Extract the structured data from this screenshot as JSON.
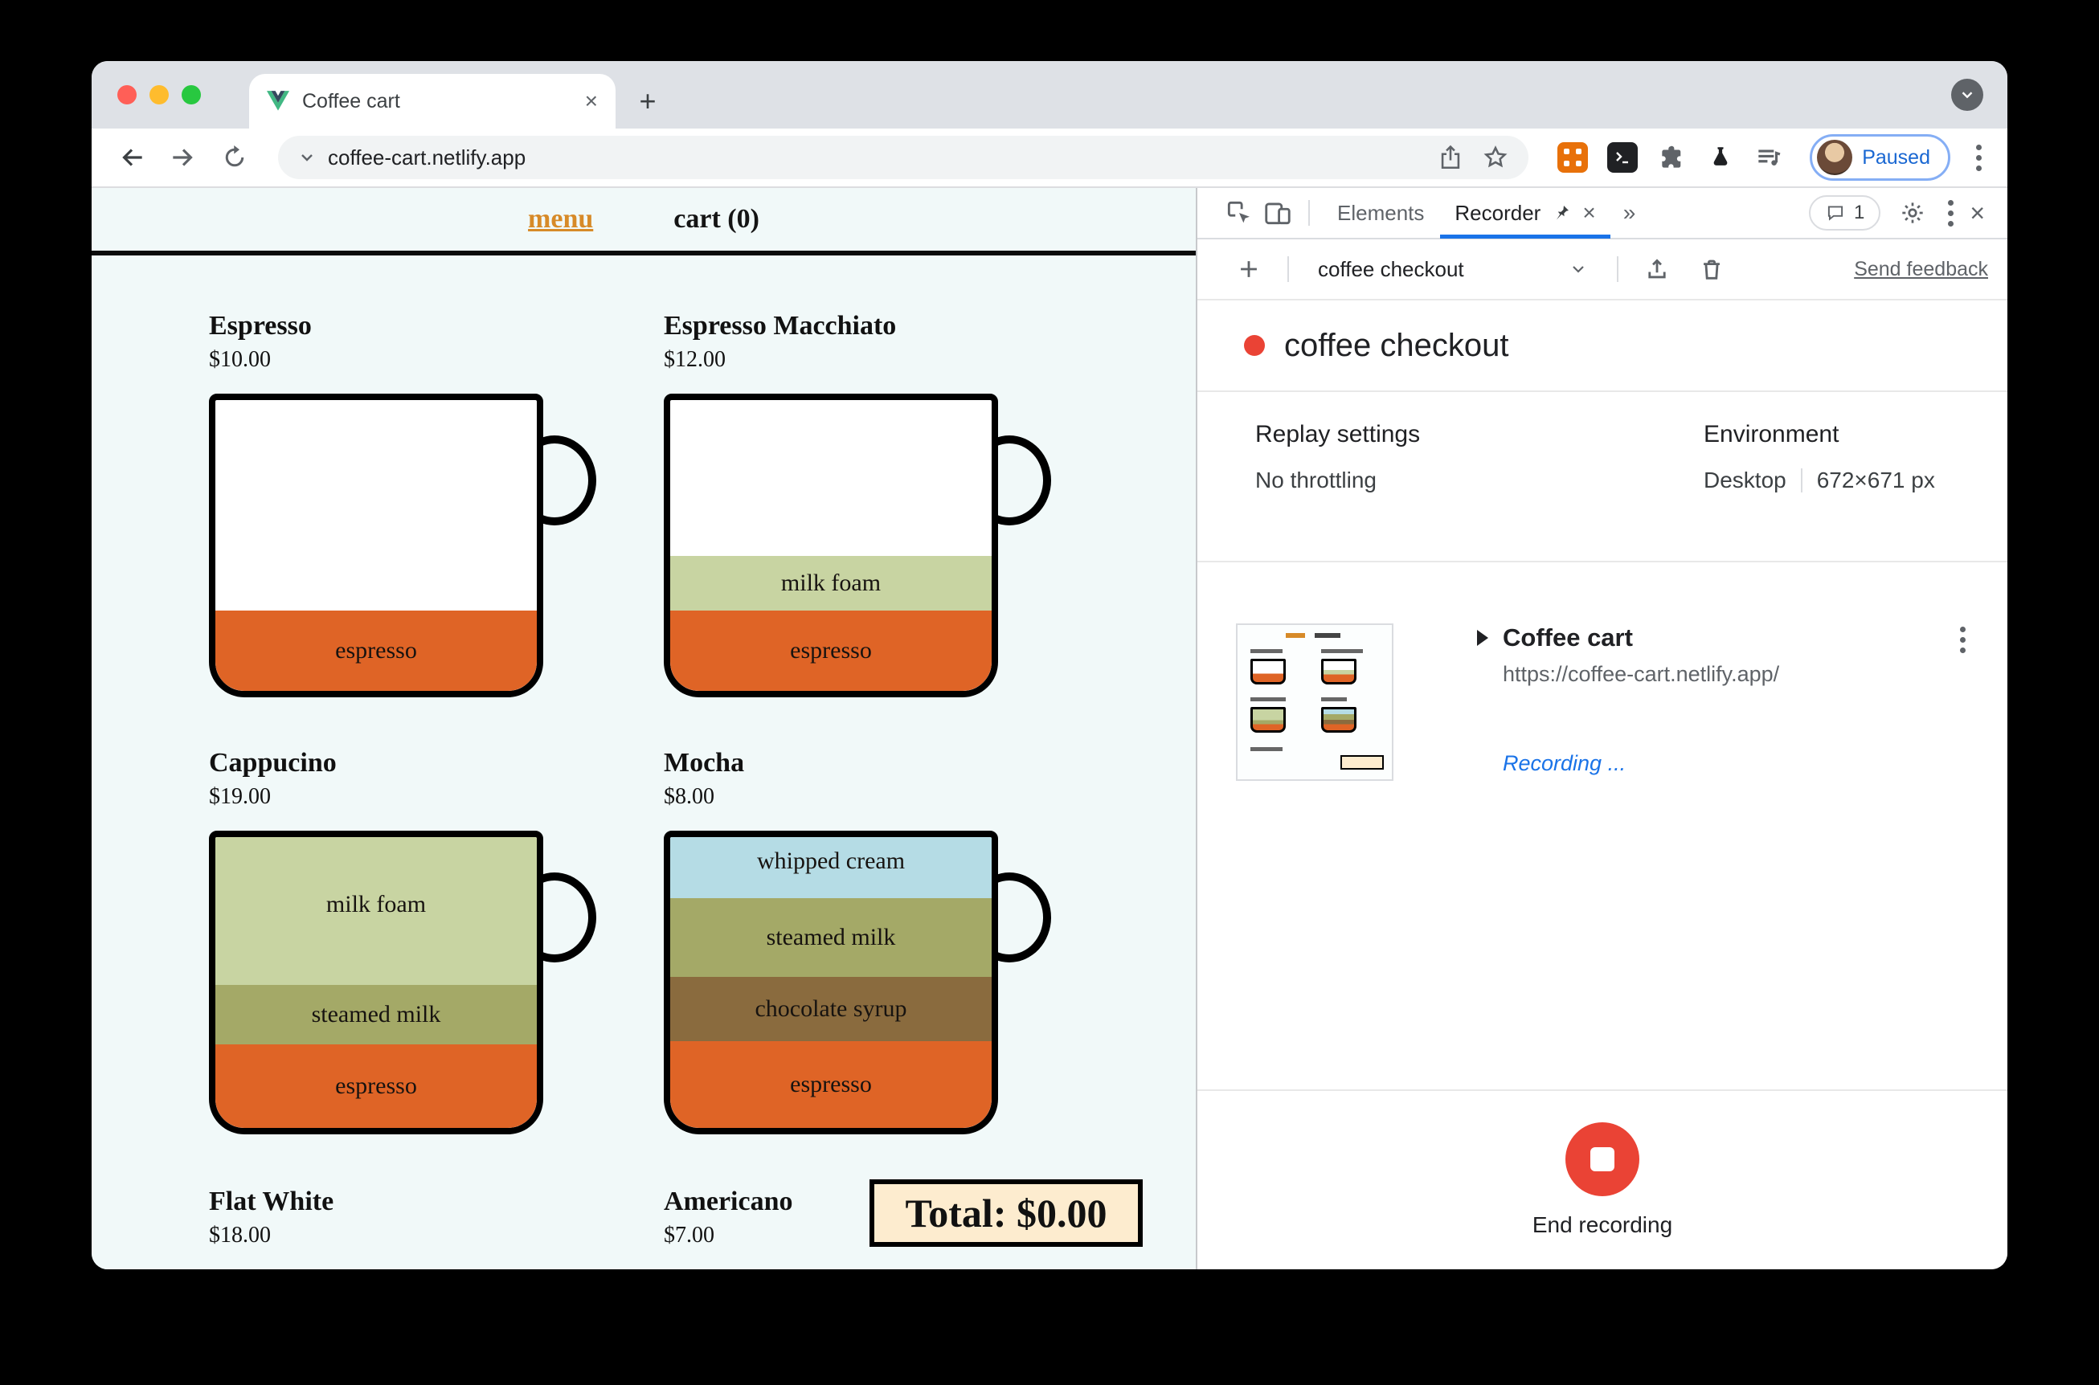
{
  "browser": {
    "tab_title": "Coffee cart",
    "url": "coffee-cart.netlify.app",
    "profile_label": "Paused"
  },
  "app": {
    "nav_menu": "menu",
    "nav_cart": "cart (0)",
    "total": "Total: $0.00",
    "layers": {
      "espresso": "espresso",
      "milk_foam": "milk foam",
      "steamed_milk": "steamed milk",
      "whipped_cream": "whipped cream",
      "chocolate_syrup": "chocolate syrup"
    },
    "items": [
      {
        "name": "Espresso",
        "price": "$10.00"
      },
      {
        "name": "Espresso Macchiato",
        "price": "$12.00"
      },
      {
        "name": "Cappucino",
        "price": "$19.00"
      },
      {
        "name": "Mocha",
        "price": "$8.00"
      },
      {
        "name": "Flat White",
        "price": "$18.00"
      },
      {
        "name": "Americano",
        "price": "$7.00"
      }
    ],
    "colors": {
      "background": "#f1f9f9",
      "menu_link": "#d78a28",
      "espresso": "#df6426",
      "milk_foam": "#c8d4a2",
      "steamed_milk": "#a4a967",
      "whipped_cream": "#b5dce5",
      "chocolate_syrup": "#8a6b3e",
      "total_bg": "#fdeccf"
    }
  },
  "devtools": {
    "tabs": {
      "elements": "Elements",
      "recorder": "Recorder",
      "more": "»"
    },
    "issues_badge": "1",
    "toolbar": {
      "recording_select": "coffee checkout",
      "send_feedback": "Send feedback"
    },
    "recording": {
      "title": "coffee checkout",
      "replay_settings_label": "Replay settings",
      "replay_settings_value": "No throttling",
      "environment_label": "Environment",
      "environment_device": "Desktop",
      "environment_viewport": "672×671 px"
    },
    "step": {
      "title": "Coffee cart",
      "url": "https://coffee-cart.netlify.app/",
      "status": "Recording ..."
    },
    "footer": {
      "end_recording": "End recording"
    },
    "accent_blue": "#1a73e8",
    "record_red": "#ea4335"
  }
}
